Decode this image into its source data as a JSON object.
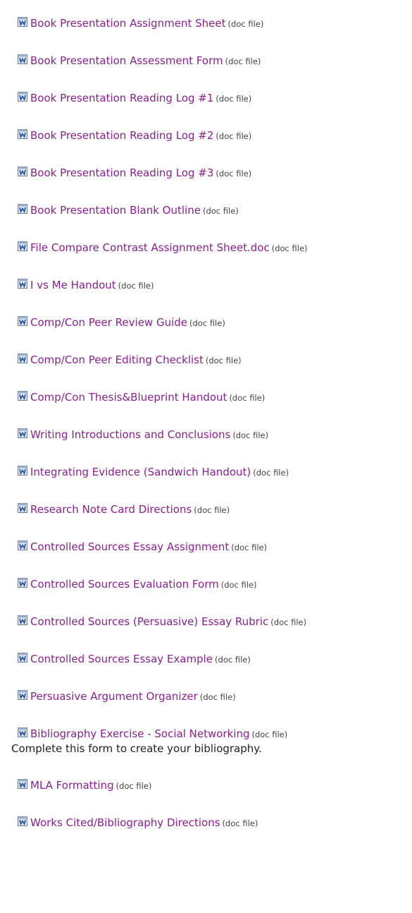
{
  "file_type_label": "(doc file)",
  "icon": "word-document-icon",
  "colors": {
    "link": "#8a1f8f",
    "text": "#222222"
  },
  "items": [
    {
      "title": "Book Presentation Assignment Sheet"
    },
    {
      "title": "Book Presentation Assessment Form"
    },
    {
      "title": "Book Presentation Reading Log #1"
    },
    {
      "title": "Book Presentation Reading Log #2"
    },
    {
      "title": "Book Presentation Reading Log #3"
    },
    {
      "title": "Book Presentation Blank Outline"
    },
    {
      "title": "File Compare Contrast Assignment Sheet.doc"
    },
    {
      "title": "I vs Me Handout"
    },
    {
      "title": "Comp/Con Peer Review Guide"
    },
    {
      "title": "Comp/Con Peer Editing Checklist"
    },
    {
      "title": "Comp/Con Thesis&Blueprint Handout"
    },
    {
      "title": "Writing Introductions and Conclusions"
    },
    {
      "title": "Integrating Evidence (Sandwich Handout)"
    },
    {
      "title": "Research Note Card Directions"
    },
    {
      "title": "Controlled Sources Essay Assignment"
    },
    {
      "title": "Controlled Sources Evaluation Form"
    },
    {
      "title": "Controlled Sources (Persuasive) Essay Rubric"
    },
    {
      "title": "Controlled Sources Essay Example"
    },
    {
      "title": "Persuasive Argument Organizer"
    },
    {
      "title": "Bibliography Exercise - Social Networking",
      "description": "Complete this form to create your bibliography."
    },
    {
      "title": "MLA Formatting"
    },
    {
      "title": "Works Cited/Bibliography Directions"
    }
  ]
}
